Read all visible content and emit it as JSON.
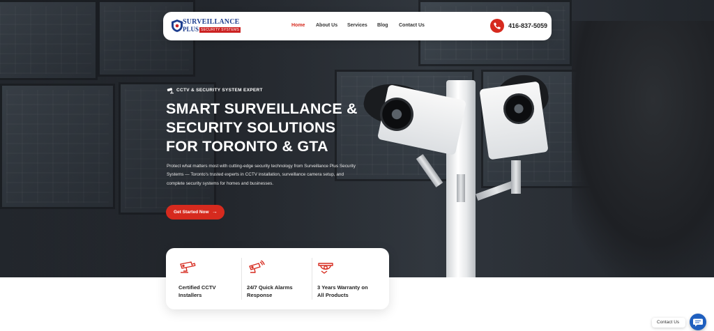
{
  "nav": {
    "logo": {
      "top": "SURVEILLANCE",
      "plus": "PLUS",
      "sub": "SECURITY SYSTEMS"
    },
    "links": [
      {
        "label": "Home",
        "active": true
      },
      {
        "label": "About Us",
        "active": false
      },
      {
        "label": "Services",
        "active": false
      },
      {
        "label": "Blog",
        "active": false
      },
      {
        "label": "Contact Us",
        "active": false
      }
    ],
    "phone": "416-837-5059",
    "phone_icon": "phone-icon"
  },
  "hero": {
    "badge": "CCTV & SECURITY SYSTEM EXPERT",
    "badge_icon": "cctv-camera-icon",
    "headline_lines": [
      "SMART SURVEILLANCE &",
      "SECURITY SOLUTIONS",
      "FOR TORONTO & GTA"
    ],
    "description": "Protect what matters most with cutting-edge security technology from Surveillance Plus Security Systems — Toronto's trusted experts in CCTV installation, surveillance camera setup, and complete security systems for homes and businesses.",
    "cta_label": "Get Started Now",
    "cta_icon": "arrow-right-icon"
  },
  "features": [
    {
      "icon": "cctv-camera-icon",
      "line1": "Certified CCTV",
      "line2": "Installers"
    },
    {
      "icon": "alarm-camera-icon",
      "line1": "24/7 Quick Alarms",
      "line2": "Response"
    },
    {
      "icon": "dome-camera-icon",
      "line1": "3 Years Warranty on",
      "line2": "All Products"
    }
  ],
  "chat": {
    "label": "Contact Us",
    "icon": "chat-icon"
  },
  "colors": {
    "accent": "#d62a1e",
    "brand_blue": "#1f3f8f",
    "chat_blue": "#1f5fbf"
  }
}
